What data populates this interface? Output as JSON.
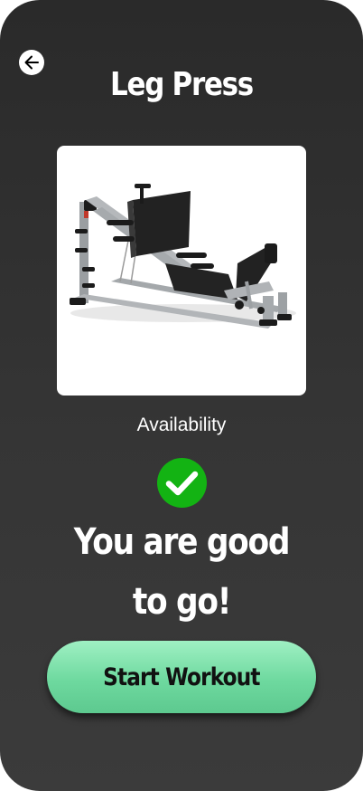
{
  "header": {
    "back_icon": "arrow-left-icon",
    "title": "Leg Press"
  },
  "equipment": {
    "image_icon": "leg-press-machine-image"
  },
  "availability": {
    "label": "Availability",
    "status_icon": "check-circle-icon",
    "status_color": "#13b313",
    "message_line1": "You are good",
    "message_line2": "to go!"
  },
  "actions": {
    "start_label": "Start Workout",
    "start_color": "#7de2ac"
  }
}
